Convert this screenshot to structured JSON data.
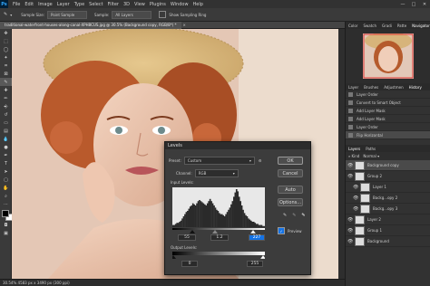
{
  "menubar": {
    "logo": "Ps",
    "items": [
      "File",
      "Edit",
      "Image",
      "Layer",
      "Type",
      "Select",
      "Filter",
      "3D",
      "View",
      "Plugins",
      "Window",
      "Help"
    ],
    "window_controls": [
      "—",
      "□",
      "✕"
    ]
  },
  "options": {
    "sample_size_label": "Sample Size:",
    "sample_size_value": "Point Sample",
    "sample_label": "Sample:",
    "sample_value": "All Layers",
    "show_ring": "Show Sampling Ring"
  },
  "doc_tab": "traditional-waterfront-houses-along-canal-XPH8CUS.jpg @ 30.5% (Background copy, RGB/8*) *",
  "status": "30.54%    4583 px x 3490 px (300 ppi)",
  "panels": {
    "top_tabs": [
      "Color",
      "Swatch",
      "Gradi",
      "Patte",
      "Navigator"
    ],
    "history_tabs": [
      "Layer",
      "Brushes",
      "Adjustmen",
      "History"
    ],
    "history_items": [
      "Layer Order",
      "Convert to Smart Object",
      "Add Layer Mask",
      "Add Layer Mask",
      "Layer Order",
      "Flip Horizontal"
    ],
    "layers_tabs": [
      "Layers",
      "Paths"
    ],
    "layers": [
      {
        "name": "Background copy",
        "indent": 0
      },
      {
        "name": "Group 2",
        "indent": 0
      },
      {
        "name": "Layer 1",
        "indent": 1
      },
      {
        "name": "Backg...opy 2",
        "indent": 1
      },
      {
        "name": "Backg...opy 3",
        "indent": 1
      },
      {
        "name": "Layer 2",
        "indent": 0
      },
      {
        "name": "Group 1",
        "indent": 0
      },
      {
        "name": "Background",
        "indent": 0
      }
    ]
  },
  "levels": {
    "title": "Levels",
    "preset_label": "Preset:",
    "preset_value": "Custom",
    "channel_label": "Channel:",
    "channel_value": "RGB",
    "input_label": "Input Levels:",
    "input_values": [
      "55",
      "1.2",
      "227"
    ],
    "output_label": "Output Levels:",
    "output_values": [
      "0",
      "255"
    ],
    "buttons": [
      "OK",
      "Cancel",
      "Auto",
      "Options..."
    ],
    "preview_label": "Preview",
    "preview_checked": true,
    "histogram": [
      2,
      2,
      3,
      4,
      4,
      5,
      6,
      8,
      10,
      12,
      14,
      15,
      17,
      19,
      20,
      22,
      21,
      20,
      22,
      24,
      25,
      24,
      23,
      22,
      21,
      20,
      22,
      24,
      26,
      24,
      22,
      20,
      18,
      16,
      15,
      13,
      12,
      12,
      11,
      10,
      12,
      14,
      16,
      18,
      21,
      24,
      28,
      32,
      35,
      33,
      28,
      24,
      20,
      16,
      13,
      11,
      10,
      8,
      7,
      6,
      5,
      5,
      4,
      3,
      3,
      2,
      2,
      2,
      1,
      1
    ]
  }
}
